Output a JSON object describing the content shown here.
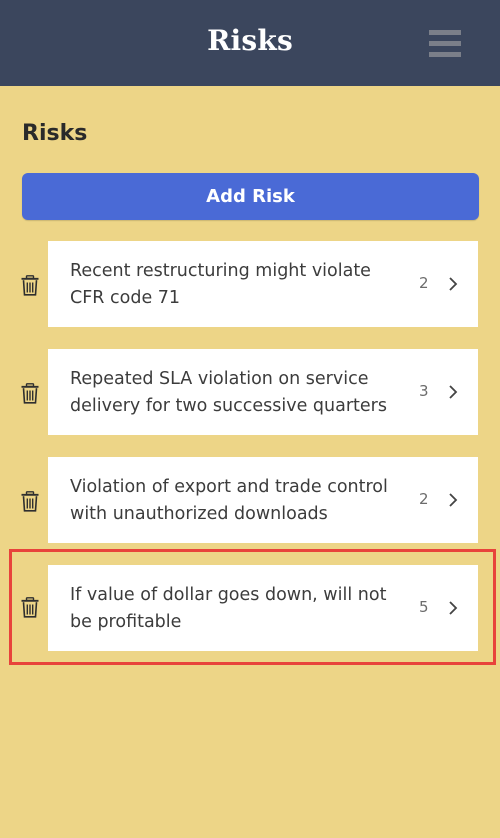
{
  "header": {
    "title": "Risks",
    "menu_icon": "hamburger-menu-icon"
  },
  "main": {
    "heading": "Risks",
    "add_button_label": "Add Risk",
    "risks": [
      {
        "text": "Recent restructuring might violate CFR code 71",
        "count": "2"
      },
      {
        "text": "Repeated SLA violation on service delivery for two successive quarters",
        "count": "3"
      },
      {
        "text": "Violation of export and trade control with unauthorized downloads",
        "count": "2"
      },
      {
        "text": "If value of dollar goes down, will not be profitable",
        "count": "5",
        "highlighted": true
      }
    ]
  },
  "colors": {
    "header_bg": "#3b465d",
    "page_bg": "#edd587",
    "button_bg": "#4a6ad6",
    "highlight_border": "#e8433b"
  }
}
